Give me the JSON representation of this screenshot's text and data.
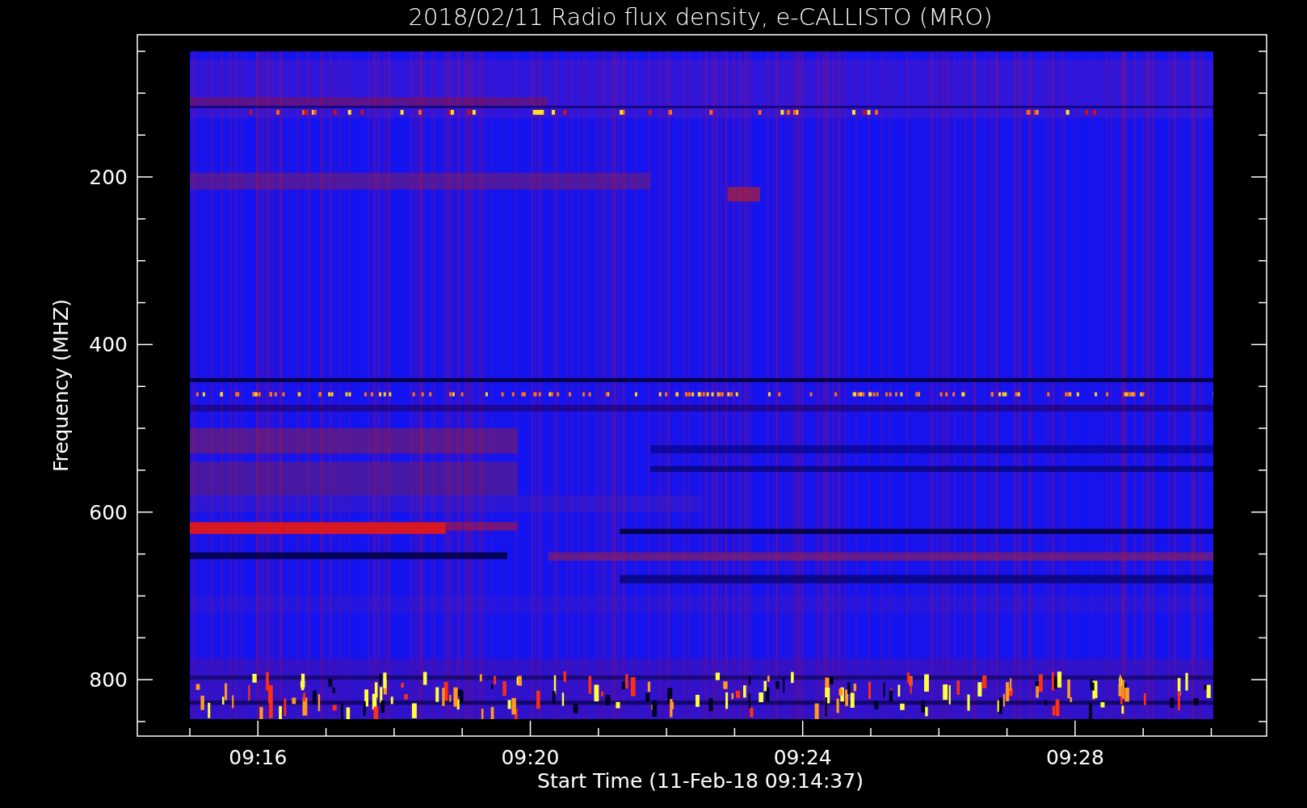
{
  "title": "2018/02/11  Radio flux density, e-CALLISTO (MRO)",
  "y_axis": {
    "label": "Frequency (MHZ)",
    "ticks": [
      "200",
      "400",
      "600",
      "800"
    ]
  },
  "x_axis": {
    "label": "Start Time (11-Feb-18 09:14:37)",
    "ticks": [
      "09:16",
      "09:20",
      "09:24",
      "09:28"
    ]
  }
}
